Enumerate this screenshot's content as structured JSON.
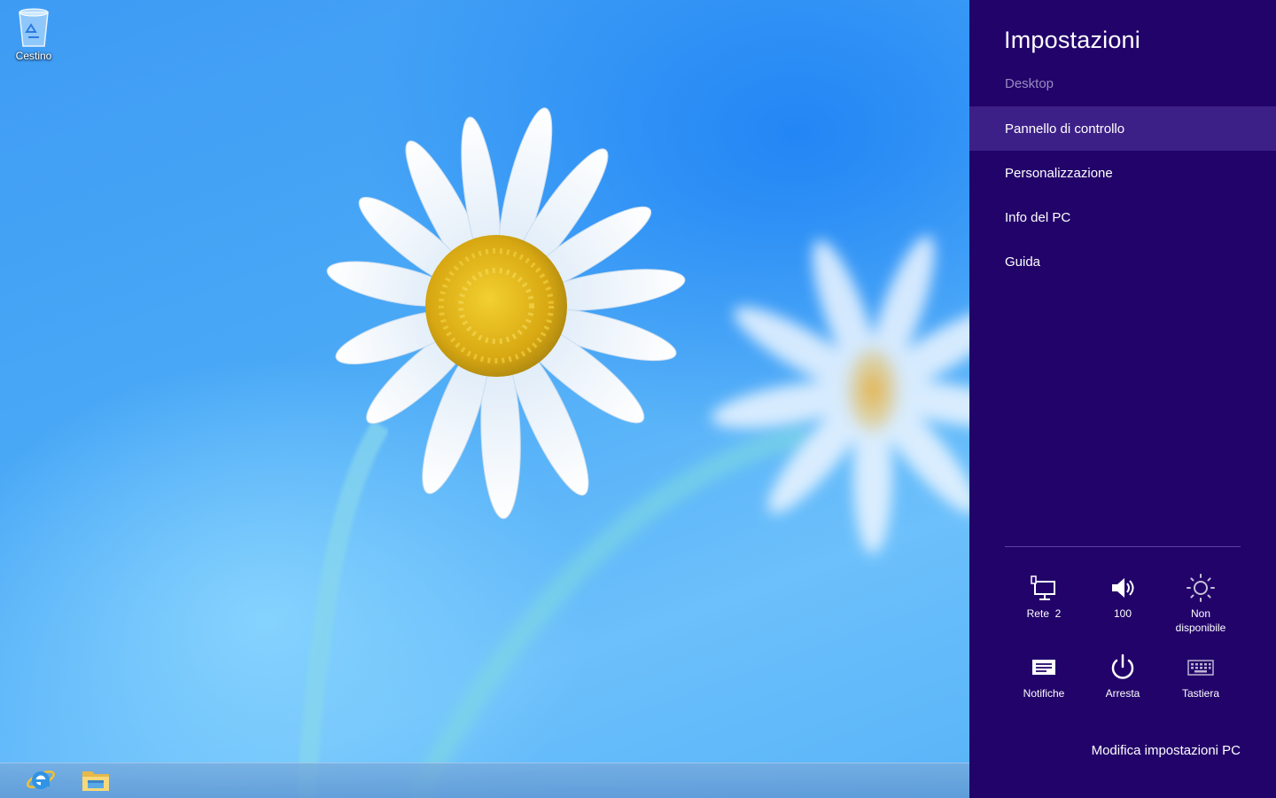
{
  "desktop": {
    "recycle_bin": {
      "label": "Cestino",
      "icon": "recycle-bin-icon"
    },
    "taskbar": {
      "pinned": [
        {
          "name": "internet-explorer",
          "icon": "internet-explorer-icon"
        },
        {
          "name": "file-explorer",
          "icon": "folder-icon"
        }
      ]
    }
  },
  "settings": {
    "title": "Impostazioni",
    "subtitle": "Desktop",
    "items": [
      {
        "label": "Pannello di controllo",
        "selected": true
      },
      {
        "label": "Personalizzazione",
        "selected": false
      },
      {
        "label": "Info del PC",
        "selected": false
      },
      {
        "label": "Guida",
        "selected": false
      }
    ],
    "quick": [
      {
        "icon": "network-icon",
        "label": "Rete  2"
      },
      {
        "icon": "volume-icon",
        "label": "100"
      },
      {
        "icon": "brightness-icon",
        "label_line1": "Non",
        "label_line2": "disponibile"
      },
      {
        "icon": "notifications-icon",
        "label": "Notifiche"
      },
      {
        "icon": "power-icon",
        "label": "Arresta"
      },
      {
        "icon": "keyboard-icon",
        "label": "Tastiera"
      }
    ],
    "change_settings_link": "Modifica impostazioni PC",
    "colors": {
      "pane_background": "#22036a",
      "selected_item": "#3d2087",
      "subtitle": "#9a8ac0"
    }
  }
}
